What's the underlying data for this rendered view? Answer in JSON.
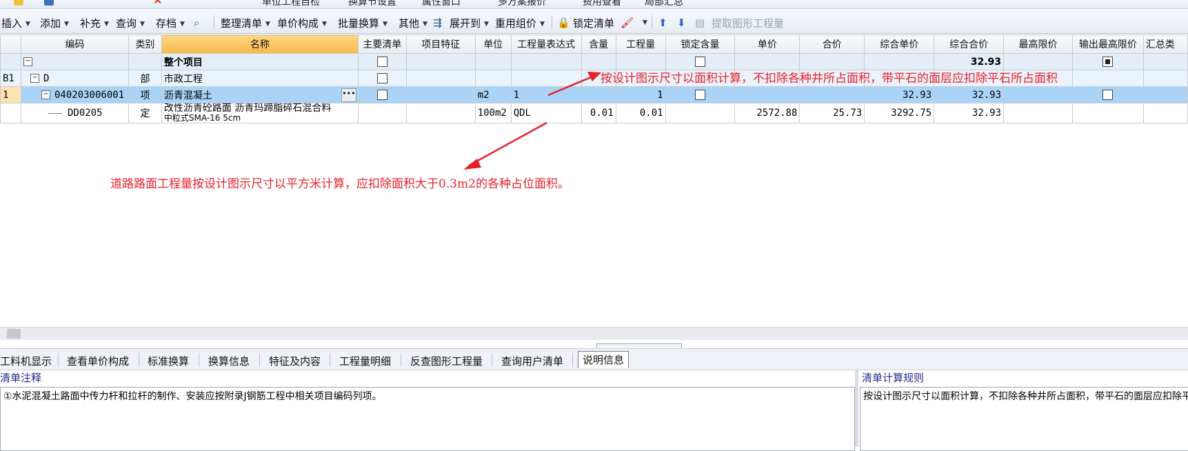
{
  "top_toolbar": {
    "items": [
      "单位工程自检",
      "换算节设置",
      "属性窗口",
      "多方案报价",
      "费用查看",
      "局部汇总"
    ]
  },
  "toolbar": {
    "insert": "插入",
    "add": "添加",
    "supplement": "补充",
    "query": "查询",
    "archive": "存档",
    "organize": "整理清单",
    "unit_price_composition": "单价构成",
    "batch_convert": "批量换算",
    "other": "其他",
    "expand_to": "展开到",
    "reuse_group_price": "重用组价",
    "lock_list": "锁定清单",
    "extract_graphic": "提取图形工程量"
  },
  "grid": {
    "headers": [
      "编码",
      "类别",
      "名称",
      "主要清单",
      "项目特征",
      "单位",
      "工程量表达式",
      "含量",
      "工程量",
      "锁定含量",
      "单价",
      "合价",
      "综合单价",
      "综合合价",
      "最高限价",
      "输出最高限价",
      "汇总类"
    ],
    "rows": {
      "total": {
        "name": "整个项目",
        "total_price": "32.93"
      },
      "d": {
        "rownum": "B1",
        "code": "D",
        "type": "部",
        "name": "市政工程"
      },
      "item": {
        "rownum": "1",
        "code": "040203006001",
        "type": "项",
        "name": "沥青混凝土",
        "unit": "m2",
        "expr": "1",
        "qty": "1",
        "comp_unit": "32.93",
        "comp_total": "32.93"
      },
      "sub": {
        "code": "DD0205",
        "type": "定",
        "name1": "改性沥青砼路面 沥青玛蹄脂碎石混合料",
        "name2": "中粒式SMA-16 5cm",
        "unit": "100m2",
        "expr": "QDL",
        "content": "0.01",
        "qty": "0.01",
        "unit_price": "2572.88",
        "total": "25.73",
        "comp_unit": "3292.75",
        "comp_total": "32.93"
      }
    }
  },
  "annotations": {
    "top": "按设计图示尺寸以面积计算，不扣除各种井所占面积，带平石的面层应扣除平石所占面积",
    "middle": "道路路面工程量按设计图示尺寸以平方米计算，应扣除面积大于0.3m2的各种占位面积。"
  },
  "bottom_tabs": [
    "工料机显示",
    "查看单价构成",
    "标准换算",
    "换算信息",
    "特征及内容",
    "工程量明细",
    "反查图形工程量",
    "查询用户清单",
    "说明信息"
  ],
  "active_tab": "说明信息",
  "panels": {
    "left_title": "清单注释",
    "left_text": "①水泥混凝土路面中传力杆和拉杆的制作、安装应按附录J钢筋工程中相关项目编码列项。",
    "right_title": "清单计算规则",
    "right_text": "按设计图示尺寸以面积计算，不扣除各种井所占面积，带平石的面层应扣除平石所占面积"
  },
  "colors": {
    "annotation": "#e8202a",
    "selected_row": "#a9d4f7",
    "header_highlight": "#f6b94a"
  }
}
